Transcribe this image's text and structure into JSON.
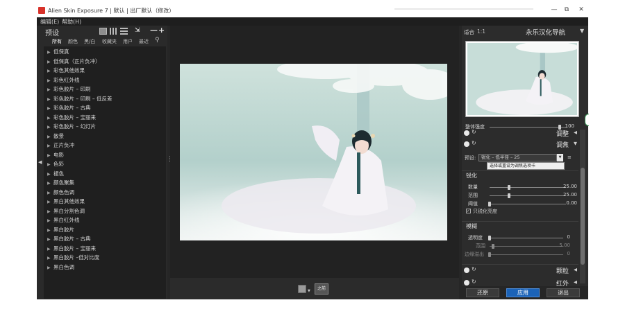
{
  "window": {
    "title": "Alien Skin Exposure 7 | 默认 | 出厂默认（修改）",
    "minimize_glyph": "—",
    "maximize_glyph": "⧉",
    "close_glyph": "✕"
  },
  "menu": {
    "edit": "编辑(E)",
    "help": "帮助(H)"
  },
  "presets_panel": {
    "title": "预设",
    "remove_glyph": "—",
    "add_glyph": "+",
    "collapse_glyph": "⇲",
    "tabs": [
      "所有",
      "颜色",
      "黑/白",
      "收藏夹",
      "用户",
      "最近"
    ],
    "items": [
      "低保真",
      "低保真（正片负冲）",
      "彩色其他效果",
      "彩色红外线",
      "彩色胶片 – 印刷",
      "彩色胶片 – 印刷 – 低反差",
      "彩色胶片 – 古典",
      "彩色胶片 – 宝丽来",
      "彩色胶片 – 幻灯片",
      "散景",
      "正片负冲",
      "电影",
      "色彩",
      "褪色",
      "颜色聚集",
      "颜色色调",
      "黑白其他效果",
      "黑白分割色调",
      "黑白红外线",
      "黑白胶片",
      "黑白胶片 – 古典",
      "黑白胶片 – 宝丽来",
      "黑白胶片 –低对比度",
      "黑白色调"
    ]
  },
  "preview": {
    "before_label": "之前"
  },
  "navigator": {
    "fit_label": "适合",
    "zoom_ratio": "1:1",
    "title": "永乐汉化导航",
    "overall_label": "整体强度",
    "overall_value": "100",
    "overall_level": 0.9
  },
  "sections": {
    "top_partial": "调整",
    "focus": {
      "name": "调焦",
      "preset_label": "预设:",
      "preset_value": "锐化 – 低半径 – 25",
      "tooltip": "选择或重设为调焦选项卡",
      "sharpen": {
        "title": "锐化",
        "amount_label": "数量",
        "amount_value": "25.00",
        "amount_level": 0.25,
        "radius_label": "范围",
        "radius_value": "25.00",
        "radius_level": 0.25,
        "threshold_label": "阈值",
        "threshold_value": "0.00",
        "threshold_level": 0.0,
        "luminance_only_label": "只锐化亮度",
        "luminance_only_checked": true
      },
      "blur": {
        "title": "模糊",
        "opacity_label": "透明度",
        "opacity_value": "0",
        "opacity_level": 0.0,
        "range_label": "范围",
        "range_value": "5.00",
        "range_level": 0.05,
        "bleed_label": "边缘溢出",
        "bleed_value": "0",
        "bleed_level": 0.0
      }
    },
    "grain": {
      "name": "颗粒"
    },
    "infrared": {
      "name": "红外"
    }
  },
  "actions": {
    "reset": "还原",
    "apply": "应用",
    "exit": "退出"
  },
  "colors": {
    "accent": "#1b63b8",
    "panel": "#2a2a2a",
    "list_bg": "#1f1f1f"
  },
  "icons": [
    "app-icon",
    "view-grid-large-icon",
    "view-grid-small-icon",
    "view-list-icon",
    "collapse-icon",
    "remove-icon",
    "add-icon",
    "search-icon",
    "chevron-right-icon",
    "chevron-down-icon",
    "chevron-left-icon",
    "reset-icon",
    "toggle-icon",
    "menu-icon",
    "compare-icon"
  ]
}
